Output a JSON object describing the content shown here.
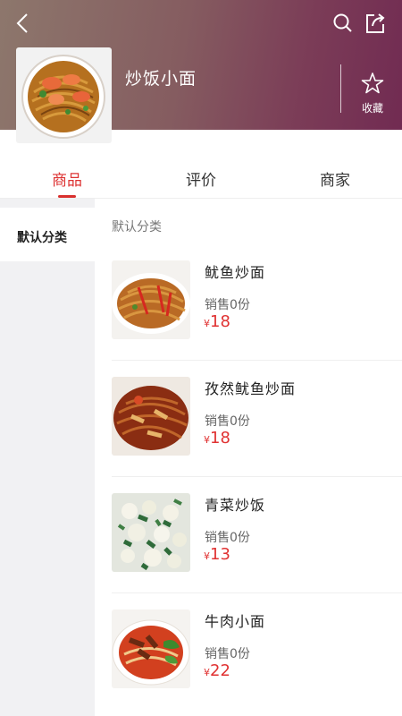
{
  "store": {
    "name": "炒饭小面",
    "favorite_label": "收藏"
  },
  "tabs": [
    {
      "label": "商品",
      "active": true
    },
    {
      "label": "评价",
      "active": false
    },
    {
      "label": "商家",
      "active": false
    }
  ],
  "sidebar": {
    "items": [
      {
        "label": "默认分类",
        "active": true
      }
    ]
  },
  "category": {
    "title": "默认分类"
  },
  "products": [
    {
      "name": "鱿鱼炒面",
      "sales": "销售0份",
      "currency": "¥",
      "price": "18"
    },
    {
      "name": "孜然鱿鱼炒面",
      "sales": "销售0份",
      "currency": "¥",
      "price": "18"
    },
    {
      "name": "青菜炒饭",
      "sales": "销售0份",
      "currency": "¥",
      "price": "13"
    },
    {
      "name": "牛肉小面",
      "sales": "销售0份",
      "currency": "¥",
      "price": "22"
    }
  ],
  "colors": {
    "accent": "#d9302e",
    "header_start": "#8d776c",
    "header_end": "#712b52"
  }
}
